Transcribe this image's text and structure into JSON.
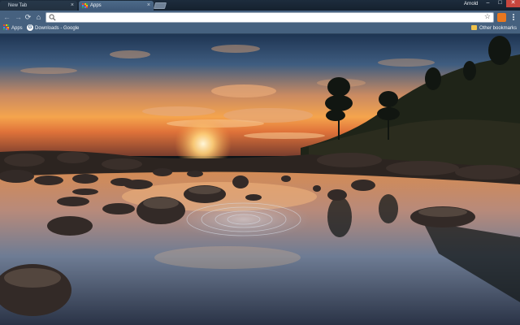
{
  "tabs": [
    {
      "label": "New Tab",
      "active": false
    },
    {
      "label": "Apps",
      "active": true
    }
  ],
  "profile": {
    "name": "Arnold"
  },
  "window_controls": {
    "minimize": "–",
    "maximize": "□",
    "close": "✕"
  },
  "toolbar": {
    "back": "←",
    "forward": "→",
    "reload": "⟳",
    "home": "⌂",
    "star": "☆"
  },
  "omnibox": {
    "value": "",
    "placeholder": ""
  },
  "bookmarks": {
    "apps_label": "Apps",
    "downloads_label": "Downloads - Google",
    "other_label": "Other bookmarks"
  },
  "colors": {
    "frame": "#1d2c3d",
    "toolbar": "#46617f",
    "active_tab": "#4d6a89",
    "close_button": "#c8463e",
    "extension_icon": "#e8771f",
    "sky_top": "#243a57",
    "sunset": "#f6a64a"
  },
  "icons": {
    "apps": "apps-grid-icon",
    "downloads": "google-g-icon",
    "other": "folder-icon",
    "menu": "three-dot-menu-icon"
  },
  "theme_image": "sunset over rocky tidal pool with ripples and pine trees"
}
